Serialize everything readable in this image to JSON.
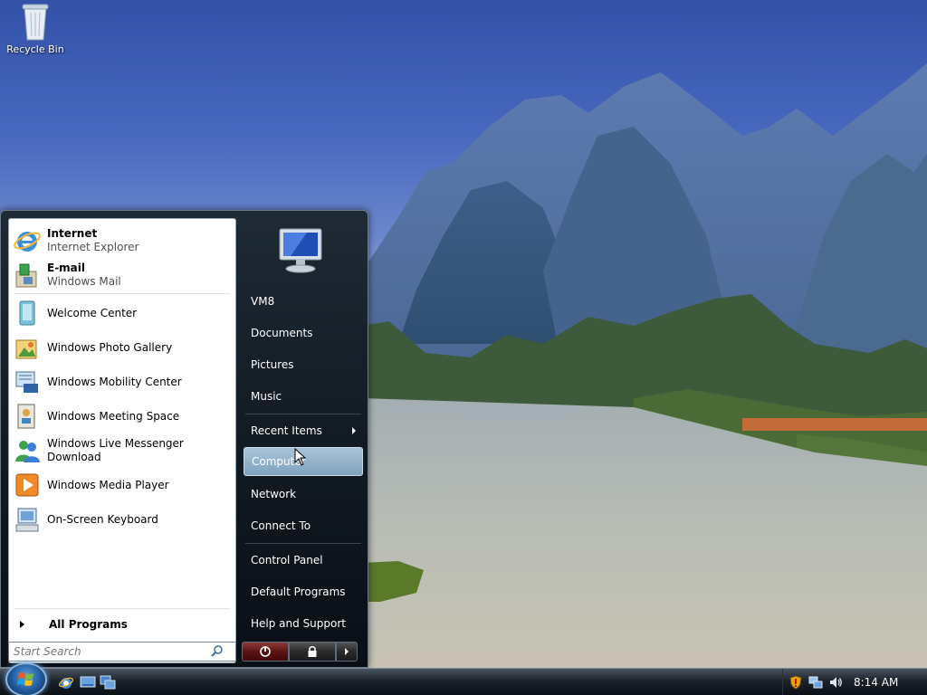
{
  "desktop": {
    "icons": [
      {
        "label": "Recycle Bin",
        "icon": "recycle-bin-icon"
      }
    ]
  },
  "start_menu": {
    "pinned": [
      {
        "title": "Internet",
        "subtitle": "Internet Explorer",
        "icon": "internet-explorer-icon"
      },
      {
        "title": "E-mail",
        "subtitle": "Windows Mail",
        "icon": "windows-mail-icon"
      }
    ],
    "recent": [
      {
        "label": "Welcome Center",
        "icon": "welcome-center-icon"
      },
      {
        "label": "Windows Photo Gallery",
        "icon": "photo-gallery-icon"
      },
      {
        "label": "Windows Mobility Center",
        "icon": "mobility-center-icon"
      },
      {
        "label": "Windows Meeting Space",
        "icon": "meeting-space-icon"
      },
      {
        "label": "Windows Live Messenger Download",
        "icon": "messenger-icon"
      },
      {
        "label": "Windows Media Player",
        "icon": "media-player-icon"
      },
      {
        "label": "On-Screen Keyboard",
        "icon": "keyboard-icon"
      }
    ],
    "all_programs": "All Programs",
    "search_placeholder": "Start Search",
    "right": {
      "user": "VM8",
      "documents": "Documents",
      "pictures": "Pictures",
      "music": "Music",
      "recent_items": "Recent Items",
      "computer": "Computer",
      "network": "Network",
      "connect_to": "Connect To",
      "control_panel": "Control Panel",
      "default_programs": "Default Programs",
      "help_support": "Help and Support"
    },
    "hovered_item": "Computer"
  },
  "taskbar": {
    "quick_launch": [
      "internet-explorer-icon",
      "show-desktop-icon",
      "switch-windows-icon"
    ],
    "tray_icons": [
      "security-shield-icon",
      "network-icon",
      "volume-icon"
    ],
    "clock": "8:14 AM"
  },
  "colors": {
    "start_menu_bg": "#101820",
    "hover_highlight": "#7fa2bd",
    "power_button": "#5a1414"
  }
}
